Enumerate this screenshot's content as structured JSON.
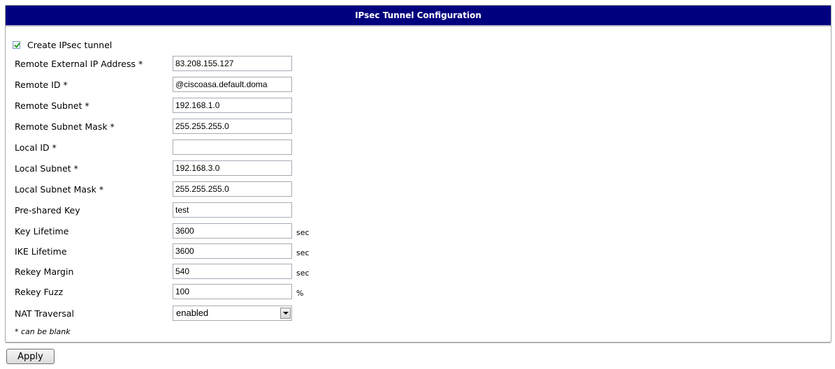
{
  "title": "IPsec Tunnel Configuration",
  "create_tunnel": {
    "label": "Create IPsec tunnel",
    "checked": true
  },
  "fields": [
    {
      "label": "Remote External IP Address *",
      "value": "83.208.155.127",
      "unit": ""
    },
    {
      "label": "Remote ID *",
      "value": "@ciscoasa.default.doma",
      "unit": ""
    },
    {
      "label": "Remote Subnet *",
      "value": "192.168.1.0",
      "unit": ""
    },
    {
      "label": "Remote Subnet Mask *",
      "value": "255.255.255.0",
      "unit": ""
    },
    {
      "label": "Local ID *",
      "value": "",
      "unit": ""
    },
    {
      "label": "Local Subnet *",
      "value": "192.168.3.0",
      "unit": ""
    },
    {
      "label": "Local Subnet Mask *",
      "value": "255.255.255.0",
      "unit": ""
    },
    {
      "label": "Pre-shared Key",
      "value": "test",
      "unit": ""
    },
    {
      "label": "Key Lifetime",
      "value": "3600",
      "unit": "sec"
    },
    {
      "label": "IKE Lifetime",
      "value": "3600",
      "unit": "sec"
    },
    {
      "label": "Rekey Margin",
      "value": "540",
      "unit": "sec"
    },
    {
      "label": "Rekey Fuzz",
      "value": "100",
      "unit": "%"
    }
  ],
  "nat": {
    "label": "NAT Traversal",
    "value": "enabled"
  },
  "note": "* can be blank",
  "apply_label": "Apply",
  "colors": {
    "titlebar": "#00007f",
    "check": "#21a121"
  }
}
